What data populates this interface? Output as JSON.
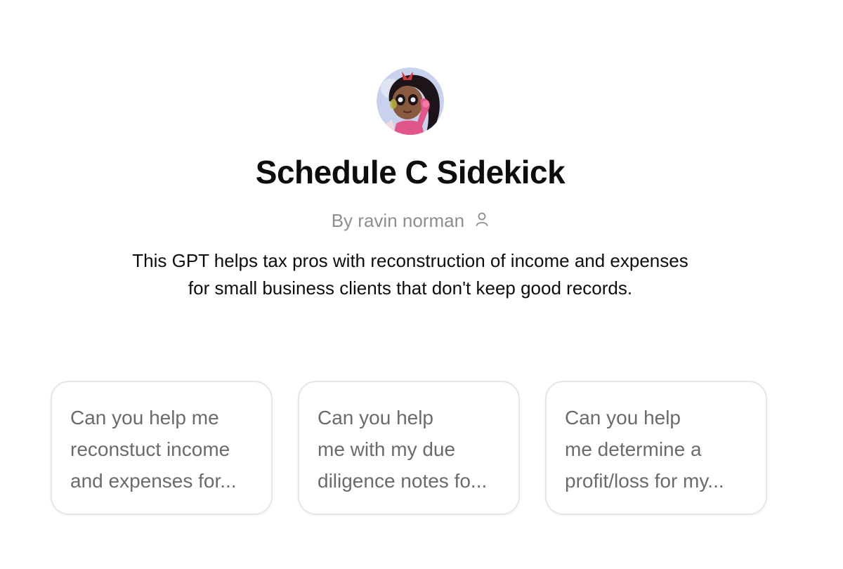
{
  "gpt": {
    "name": "Schedule C Sidekick",
    "author_prefix": "By",
    "author_name": "ravin norman",
    "avatar_icon": "cartoon-avatar-with-phone",
    "author_icon": "person-icon",
    "description_lines": [
      "This GPT helps tax pros with reconstruction of income and expenses",
      "for small business clients that don't keep good records."
    ]
  },
  "starters": [
    {
      "lines": [
        "Can you help me",
        "reconstuct income",
        "and expenses for..."
      ]
    },
    {
      "lines": [
        "Can you help",
        "me with my due",
        "diligence notes fo..."
      ]
    },
    {
      "lines": [
        "Can you help",
        "me determine a",
        "profit/loss for my..."
      ]
    }
  ],
  "colors": {
    "title": "#0d0d0d",
    "muted": "#8e8e8e",
    "card_text": "#6b6b6b",
    "card_border": "#e6e6e6"
  }
}
